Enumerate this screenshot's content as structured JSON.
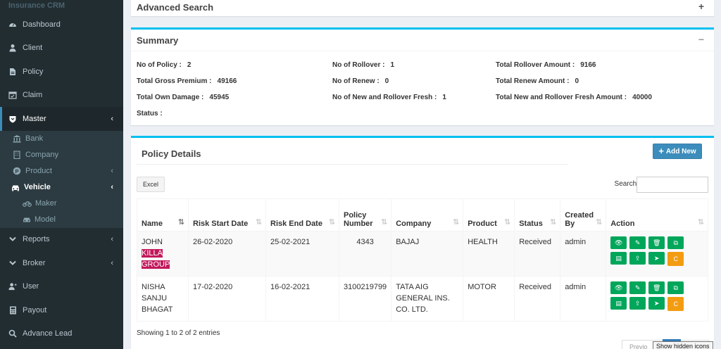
{
  "brand": "Insurance CRM",
  "sidebar": {
    "items": [
      {
        "label": "Dashboard"
      },
      {
        "label": "Client"
      },
      {
        "label": "Policy"
      },
      {
        "label": "Claim"
      },
      {
        "label": "Master"
      },
      {
        "label": "Reports"
      },
      {
        "label": "Broker"
      },
      {
        "label": "User"
      },
      {
        "label": "Payout"
      },
      {
        "label": "Advance Lead"
      }
    ],
    "master_sub": [
      "Bank",
      "Company",
      "Product",
      "Vehicle"
    ],
    "vehicle_sub": [
      "Maker",
      "Model"
    ]
  },
  "advanced_search": {
    "title": "Advanced Search",
    "toggle": "+"
  },
  "summary": {
    "title": "Summary",
    "toggle": "−",
    "fields": {
      "no_of_policy": {
        "label": "No of Policy :",
        "value": "2"
      },
      "total_gross_premium": {
        "label": "Total Gross Premium :",
        "value": "49166"
      },
      "total_own_damage": {
        "label": "Total Own Damage :",
        "value": "45945"
      },
      "status": {
        "label": "Status :",
        "value": ""
      },
      "no_of_rollover": {
        "label": "No of Rollover :",
        "value": "1"
      },
      "no_of_renew": {
        "label": "No of Renew :",
        "value": "0"
      },
      "no_new_rollover_fresh": {
        "label": "No of New and Rollover Fresh :",
        "value": "1"
      },
      "total_rollover_amount": {
        "label": "Total Rollover Amount :",
        "value": "9166"
      },
      "total_renew_amount": {
        "label": "Total Renew Amount :",
        "value": "0"
      },
      "total_new_rollover_fresh_amount": {
        "label": "Total New and Rollover Fresh Amount :",
        "value": "40000"
      }
    }
  },
  "policy_details": {
    "title": "Policy Details",
    "add_new": "Add New",
    "excel": "Excel",
    "search_label": "Search:",
    "search_value": "",
    "columns": [
      "Name",
      "Risk Start Date",
      "Risk End Date",
      "Policy Number",
      "Company",
      "Product",
      "Status",
      "Created By",
      "Action"
    ],
    "rows": [
      {
        "name_first": "JOHN",
        "name_hl": "KILLA GROUP",
        "risk_start": "26-02-2020",
        "risk_end": "25-02-2021",
        "policy_number": "4343",
        "company": "BAJAJ",
        "product": "HEALTH",
        "status": "Received",
        "created_by": "admin"
      },
      {
        "name_first": "NISHA SANJU BHAGAT",
        "name_hl": "",
        "risk_start": "17-02-2020",
        "risk_end": "16-02-2021",
        "policy_number": "3100219799",
        "company": "TATA AIG GENERAL INS. CO. LTD.",
        "product": "MOTOR",
        "status": "Received",
        "created_by": "admin"
      }
    ],
    "info": "Showing 1 to 2 of 2 entries",
    "pager_prev": "Previo",
    "tooltip": "Show hidden icons",
    "action_icons": [
      "eye-icon",
      "edit-icon",
      "trash-icon",
      "copy-icon",
      "pdf-icon",
      "upload-icon",
      "send-icon"
    ],
    "action_last_label": "C"
  },
  "colors": {
    "sidebar": "#222d32",
    "accent": "#3c8dbc",
    "box_top": "#00c0ef",
    "green": "#00a65a",
    "orange": "#f39c12",
    "highlight": "#c2185b"
  }
}
